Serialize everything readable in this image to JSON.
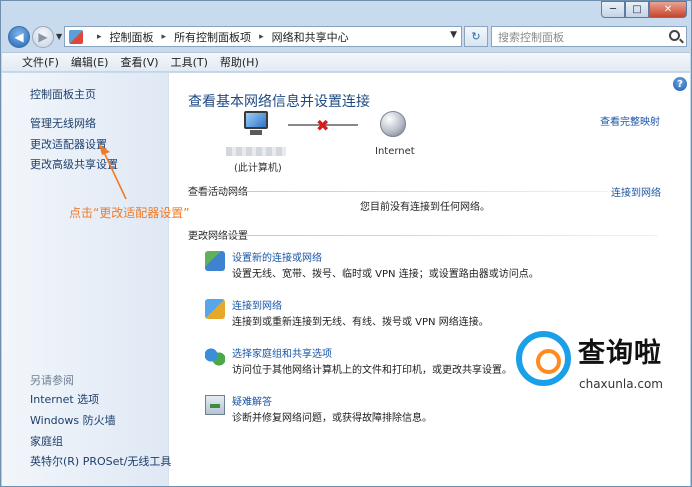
{
  "window": {
    "min_label": "─",
    "max_label": "□",
    "close_label": "✕"
  },
  "address": {
    "breadcrumbs": [
      "控制面板",
      "所有控制面板项",
      "网络和共享中心"
    ],
    "search_placeholder": "搜索控制面板"
  },
  "menu": [
    "文件(F)",
    "编辑(E)",
    "查看(V)",
    "工具(T)",
    "帮助(H)"
  ],
  "sidebar": {
    "home": "控制面板主页",
    "links": [
      "管理无线网络",
      "更改适配器设置",
      "更改高级共享设置"
    ],
    "see_also_title": "另请参阅",
    "see_also": [
      "Internet 选项",
      "Windows 防火墙",
      "家庭组",
      "英特尔(R) PROSet/无线工具"
    ]
  },
  "main": {
    "title": "查看基本网络信息并设置连接",
    "view_full_map": "查看完整映射",
    "computer_label": "(此计算机)",
    "internet_label": "Internet",
    "active_networks_label": "查看活动网络",
    "connect_to_network": "连接到网络",
    "no_connection": "您目前没有连接到任何网络。",
    "change_settings_label": "更改网络设置",
    "tasks": [
      {
        "icon": "setup-connection-icon",
        "link": "设置新的连接或网络",
        "desc": "设置无线、宽带、拨号、临时或 VPN 连接；或设置路由器或访问点。"
      },
      {
        "icon": "connect-network-icon",
        "link": "连接到网络",
        "desc": "连接到或重新连接到无线、有线、拨号或 VPN 网络连接。"
      },
      {
        "icon": "homegroup-icon",
        "link": "选择家庭组和共享选项",
        "desc": "访问位于其他网络计算机上的文件和打印机，或更改共享设置。"
      },
      {
        "icon": "troubleshoot-icon",
        "link": "疑难解答",
        "desc": "诊断并修复网络问题，或获得故障排除信息。"
      }
    ]
  },
  "annotation": {
    "text": "点击“更改适配器设置”",
    "color": "#f07a28"
  },
  "watermark": {
    "title": "查询啦",
    "url": "chaxunla.com",
    "colors": {
      "ring": "#1aa0e8",
      "inner": "#ff8a1e"
    }
  },
  "help_icon_label": "?"
}
